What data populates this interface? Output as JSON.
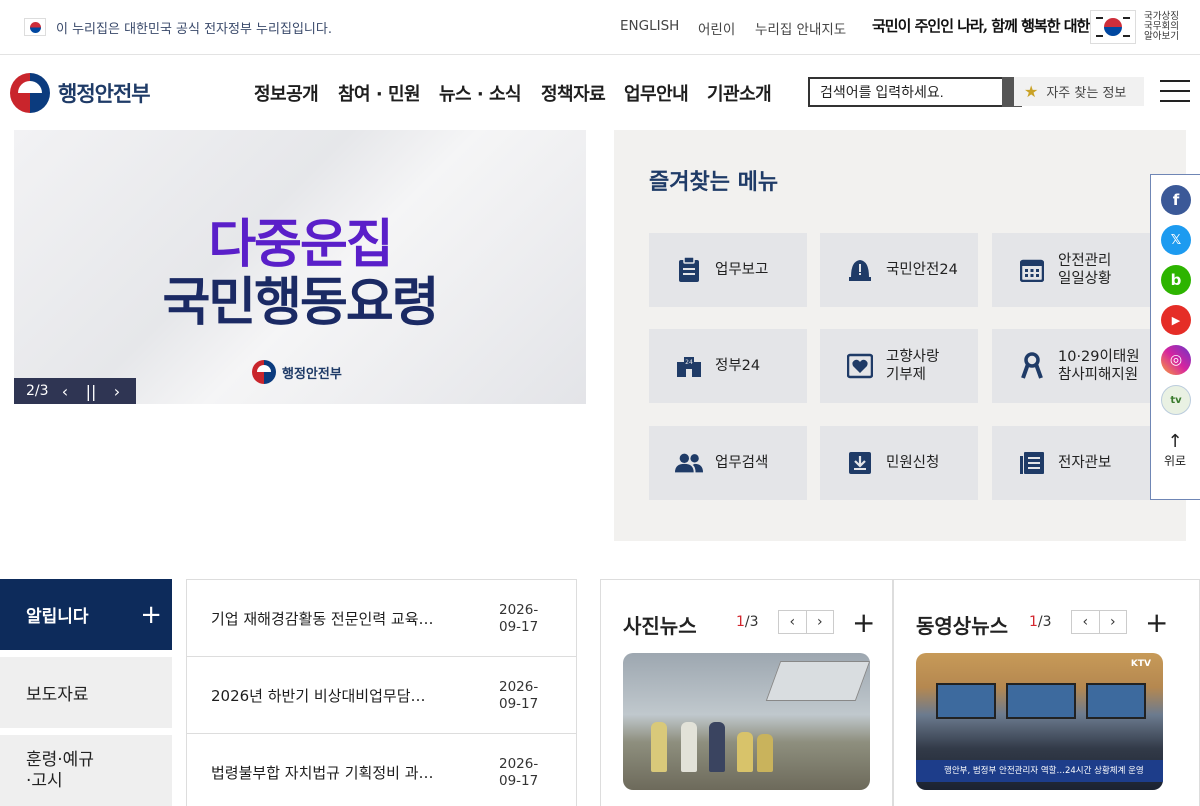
{
  "topbar": {
    "gov_notice": "이 누리집은 대한민국 공식 전자정부 누리집입니다.",
    "links": [
      "ENGLISH",
      "어린이",
      "누리집 안내지도"
    ],
    "slogan": "국민이 주인인 나라, 함께 행복한 대한민국",
    "symbol_text": [
      "국가상징",
      "국무회의",
      "알아보기"
    ]
  },
  "header": {
    "logo_text": "행정안전부",
    "nav": [
      "정보공개",
      "참여 · 민원",
      "뉴스 · 소식",
      "정책자료",
      "업무안내",
      "기관소개"
    ],
    "search_placeholder": "검색어를 입력하세요.",
    "fav_button": "자주 찾는 정보"
  },
  "banner": {
    "line1": "다중운집",
    "line2": "국민행동요령",
    "logo_text": "행정안전부",
    "counter": "2/3",
    "prev": "‹",
    "pause": "||",
    "next": "›"
  },
  "favorites": {
    "title": "즐겨찾는 메뉴",
    "items": [
      {
        "label": "업무보고",
        "icon": "clipboard-icon"
      },
      {
        "label": "국민안전24",
        "icon": "alert-bell-icon"
      },
      {
        "label": "안전관리\n일일상황",
        "icon": "calendar-icon"
      },
      {
        "label": "정부24",
        "icon": "gov24-icon"
      },
      {
        "label": "고향사랑\n기부제",
        "icon": "heart-box-icon"
      },
      {
        "label": "10·29이태원\n참사피해지원",
        "icon": "ribbon-icon"
      },
      {
        "label": "업무검색",
        "icon": "people-icon"
      },
      {
        "label": "민원신청",
        "icon": "download-box-icon"
      },
      {
        "label": "전자관보",
        "icon": "document-list-icon"
      }
    ]
  },
  "sns": {
    "items": [
      {
        "name": "facebook-icon",
        "glyph": "f",
        "color": "#3b5998"
      },
      {
        "name": "x-icon",
        "glyph": "𝕏",
        "color": "#1d9bf0"
      },
      {
        "name": "blog-icon",
        "glyph": "b",
        "color": "#2db400"
      },
      {
        "name": "youtube-icon",
        "glyph": "▶",
        "color": "#e52d27"
      },
      {
        "name": "instagram-icon",
        "glyph": "◎",
        "color": "#d6249f"
      },
      {
        "name": "tv-icon",
        "glyph": "tv",
        "color": "#e9f1e3"
      }
    ],
    "top_label": "위로"
  },
  "notice": {
    "tabs": [
      {
        "label": "알립니다",
        "active": true
      },
      {
        "label": "보도자료",
        "active": false
      },
      {
        "label": "훈령·예규\n·고시",
        "active": false
      }
    ],
    "rows": [
      {
        "title": "기업 재해경감활동 전문인력 교육…",
        "date": "2026-\n09-17"
      },
      {
        "title": "2026년 하반기 비상대비업무담…",
        "date": "2026-\n09-17"
      },
      {
        "title": "법령불부합 자치법규 기획정비 과…",
        "date": "2026-\n09-17"
      }
    ]
  },
  "photo_news": {
    "title": "사진뉴스",
    "page_current": "1",
    "page_total": "/3"
  },
  "video_news": {
    "title": "동영상뉴스",
    "page_current": "1",
    "page_total": "/3",
    "caption": "행안부, 범정부 안전관리자 역할…24시간 상황체계 운영",
    "channel": "KTV"
  }
}
